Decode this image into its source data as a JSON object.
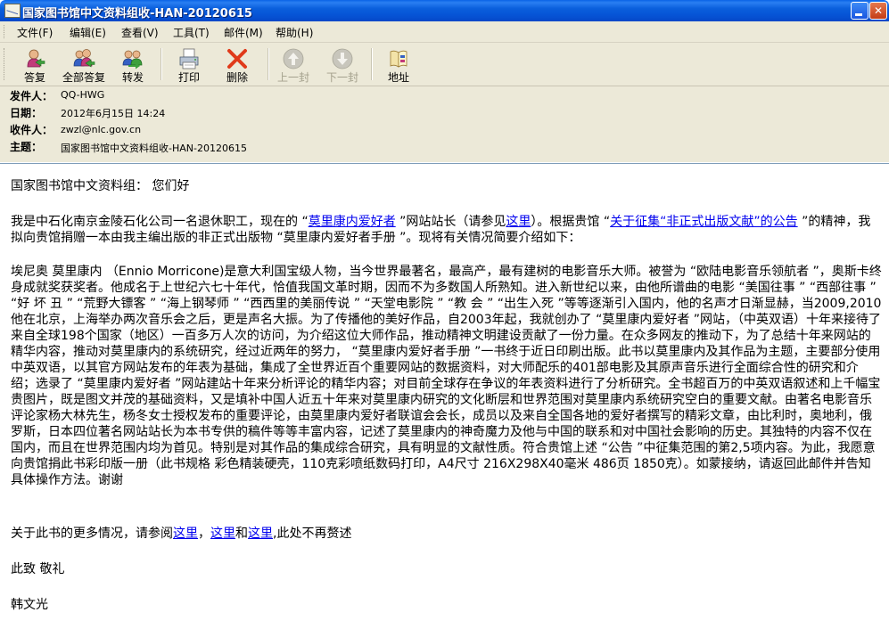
{
  "window": {
    "title": "国家图书馆中文资料组收-HAN-20120615",
    "minimize_label": "",
    "close_label": "✕"
  },
  "menu": [
    {
      "label": "文件(F)"
    },
    {
      "label": "编辑(E)"
    },
    {
      "label": "查看(V)"
    },
    {
      "label": "工具(T)"
    },
    {
      "label": "邮件(M)"
    },
    {
      "label": "帮助(H)"
    }
  ],
  "toolbar": {
    "reply": "答复",
    "reply_all": "全部答复",
    "forward": "转发",
    "print": "打印",
    "delete": "删除",
    "prev": "上一封",
    "next": "下一封",
    "addresses": "地址"
  },
  "header": {
    "from_label": "发件人：",
    "from_value": "QQ-HWG",
    "date_label": "日期：",
    "date_value": "2012年6月15日 14:24",
    "to_label": "收件人：",
    "to_value": "zwzl@nlc.gov.cn",
    "subject_label": "主题：",
    "subject_value": "国家图书馆中文资料组收-HAN-20120615"
  },
  "body": {
    "greeting": "国家图书馆中文资料组：  您们好",
    "p1_a": "我是中石化南京金陵石化公司一名退休职工，现在的 “",
    "p1_link1": "莫里康内爱好者",
    "p1_b": " ”网站站长（请参见",
    "p1_link2": "这里",
    "p1_c": "）。根据贵馆 “",
    "p1_link3": "关于征集“非正式出版文献”的公告",
    "p1_d": " ”的精神，我拟向贵馆捐赠一本由我主编出版的非正式出版物 “莫里康内爱好者手册 ”。现将有关情况简要介绍如下：",
    "p2": "埃尼奥 莫里康内 （Ennio Morricone)是意大利国宝级人物，当今世界最著名，最高产，最有建树的电影音乐大师。被誉为 “欧陆电影音乐领航者 ”，奥斯卡终身成就奖获奖者。他成名于上世纪六七十年代，恰值我国文革时期，因而不为多数国人所熟知。进入新世纪以来，由他所谱曲的电影 “美国往事 ” “西部往事 ” “好 坏 丑 ” “荒野大镖客 ” “海上钢琴师 ” “西西里的美丽传说 ” “天堂电影院 ” “教 会 ” “出生入死 ”等等逐渐引入国内，他的名声才日渐显赫，当2009,2010他在北京，上海举办两次音乐会之后，更是声名大振。为了传播他的美好作品，自2003年起，我就创办了 “莫里康内爱好者 ”网站，（中英双语）十年来接待了来自全球198个国家（地区）一百多万人次的访问，为介绍这位大师作品，推动精神文明建设贡献了一份力量。在众多网友的推动下，为了总结十年来网站的精华内容，推动对莫里康内的系统研究，经过近两年的努力， “莫里康内爱好者手册 ”一书终于近日印刷出版。此书以莫里康内及其作品为主题，主要部分使用中英双语，以其官方网站发布的年表为基础，集成了全世界近百个重要网站的数据资料，对大师配乐的401部电影及其原声音乐进行全面综合性的研究和介绍；选录了 “莫里康内爱好者 ”网站建站十年来分析评论的精华内容；对目前全球存在争议的年表资料进行了分析研究。全书超百万的中英双语叙述和上千幅宝贵图片，既是图文并茂的基础资料，又是填补中国人近五十年来对莫里康内研究的文化断层和世界范围对莫里康内系统研究空白的重要文献。由著名电影音乐评论家杨大林先生，杨冬女士授权发布的重要评论，由莫里康内爱好者联谊会会长，成员以及来自全国各地的爱好者撰写的精彩文章，由比利时，奥地利，俄罗斯，日本四位著名网站站长为本书专供的稿件等等丰富内容，记述了莫里康内的神奇魔力及他与中国的联系和对中国社会影响的历史。其独特的内容不仅在国内，而且在世界范围内均为首见。特别是对其作品的集成综合研究，具有明显的文献性质。符合贵馆上述 “公告 ”中征集范围的第2,5项内容。为此，我愿意向贵馆捐此书彩印版一册（此书规格 彩色精装硬壳，110克彩喷纸数码打印，A4尺寸 216X298X40毫米 486页 1850克）。如蒙接纳，请返回此邮件并告知具体操作方法。谢谢",
    "p3_a": "关于此书的更多情况，请参阅",
    "p3_link1": "这里",
    "p3_b": "，",
    "p3_link2": "这里",
    "p3_c": "和",
    "p3_link3": "这里",
    "p3_d": ",此处不再赘述",
    "closing": "此致  敬礼",
    "signature": "韩文光"
  },
  "icons": {
    "app": "mail-message-icon",
    "reply": "reply-icon",
    "reply_all": "reply-all-icon",
    "forward": "forward-icon",
    "print": "printer-icon",
    "delete": "delete-x-icon",
    "prev": "up-arrow-icon",
    "next": "down-arrow-icon",
    "addresses": "address-book-icon"
  },
  "colors": {
    "titlebar": "#0a5fdc",
    "chrome": "#ece9d8",
    "link": "#0000ee",
    "delete": "#e03a1a"
  }
}
